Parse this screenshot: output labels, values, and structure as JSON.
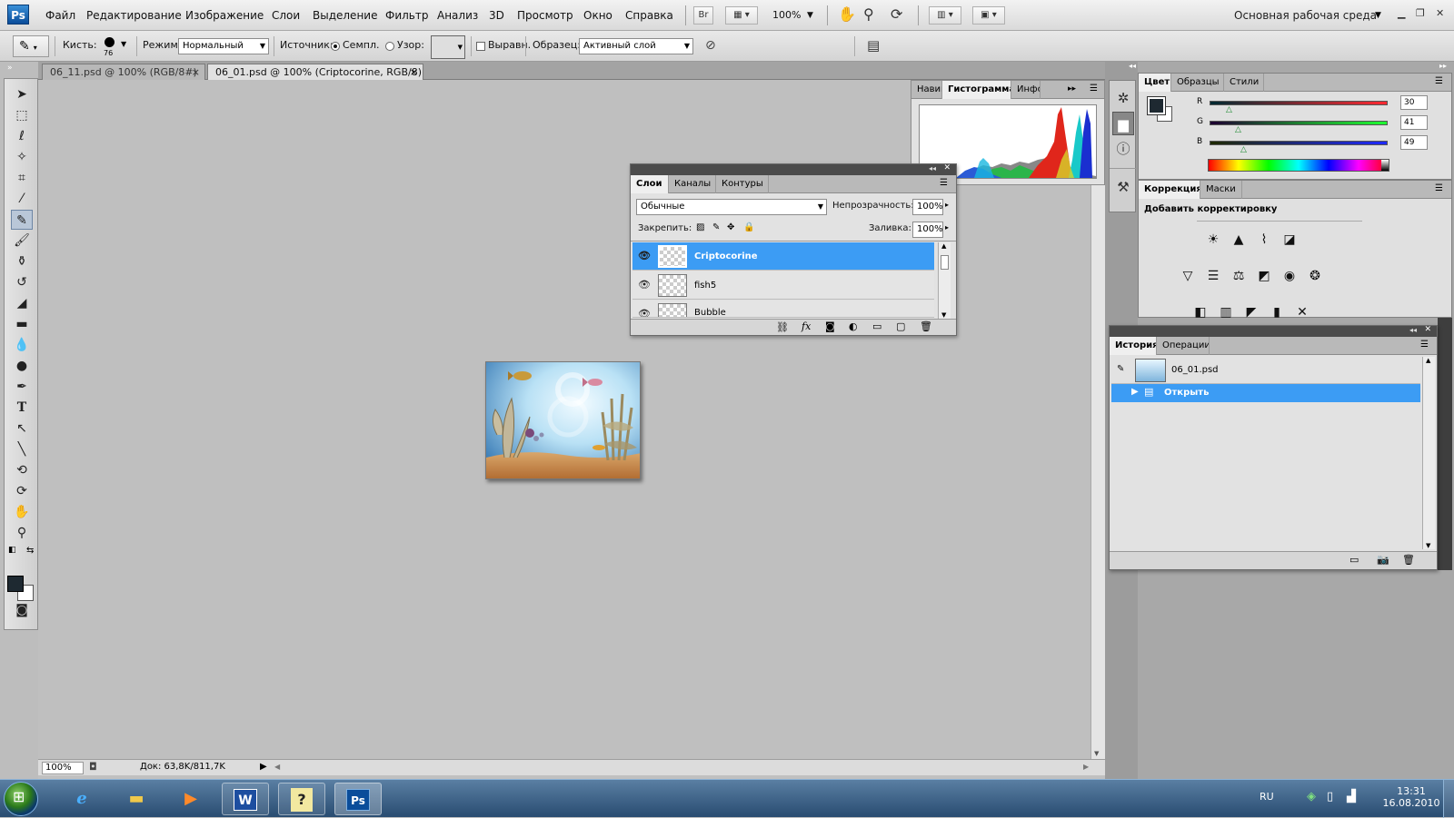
{
  "app": {
    "logo": "Ps"
  },
  "menu": [
    "Файл",
    "Редактирование",
    "Изображение",
    "Слои",
    "Выделение",
    "Фильтр",
    "Анализ",
    "3D",
    "Просмотр",
    "Окно",
    "Справка"
  ],
  "appbar": {
    "bridge": "Br",
    "zoom": "100%",
    "workspace": "Основная рабочая среда"
  },
  "options": {
    "brush_label": "Кисть:",
    "brush_size": "76",
    "mode_label": "Режим:",
    "mode_value": "Нормальный",
    "source_label": "Источник:",
    "source_sampled": "Семпл.",
    "source_pattern": "Узор:",
    "aligned_label": "Выравн.",
    "sample_label": "Образец:",
    "sample_value": "Активный слой"
  },
  "doc_tabs": [
    {
      "label": "06_11.psd @ 100% (RGB/8#)",
      "active": false
    },
    {
      "label": "06_01.psd @ 100% (Criptocorine, RGB/8)",
      "active": true
    }
  ],
  "status": {
    "zoom": "100%",
    "doc_info": "Док: 63,8K/811,7K"
  },
  "histogram_panel": {
    "tabs": [
      "Навиг",
      "Гистограмма",
      "Инфо"
    ],
    "active": "Гистограмма"
  },
  "layers_panel": {
    "tabs": [
      "Слои",
      "Каналы",
      "Контуры"
    ],
    "blend_mode": "Обычные",
    "opacity_label": "Непрозрачность:",
    "opacity_value": "100%",
    "lock_label": "Закрепить:",
    "fill_label": "Заливка:",
    "fill_value": "100%",
    "layers": [
      {
        "name": "Criptocorine",
        "selected": true
      },
      {
        "name": "fish5",
        "selected": false
      },
      {
        "name": "Bubble",
        "selected": false
      }
    ]
  },
  "color_panel": {
    "tabs": [
      "Цвет",
      "Образцы",
      "Стили"
    ],
    "r_label": "R",
    "g_label": "G",
    "b_label": "B",
    "r": "30",
    "g": "41",
    "b": "49",
    "fg_color": "#1e2931"
  },
  "correction_panel": {
    "tabs": [
      "Коррекция",
      "Маски"
    ],
    "title": "Добавить корректировку"
  },
  "history_panel": {
    "tabs": [
      "История",
      "Операции"
    ],
    "snapshot": "06_01.psd",
    "items": [
      {
        "name": "Открыть",
        "selected": true
      }
    ]
  },
  "taskbar": {
    "lang": "RU",
    "time": "13:31",
    "date": "16.08.2010",
    "active_app": "Ps"
  },
  "colors": {
    "selection": "#3c9cf4",
    "accent": "#0a4d9a"
  }
}
